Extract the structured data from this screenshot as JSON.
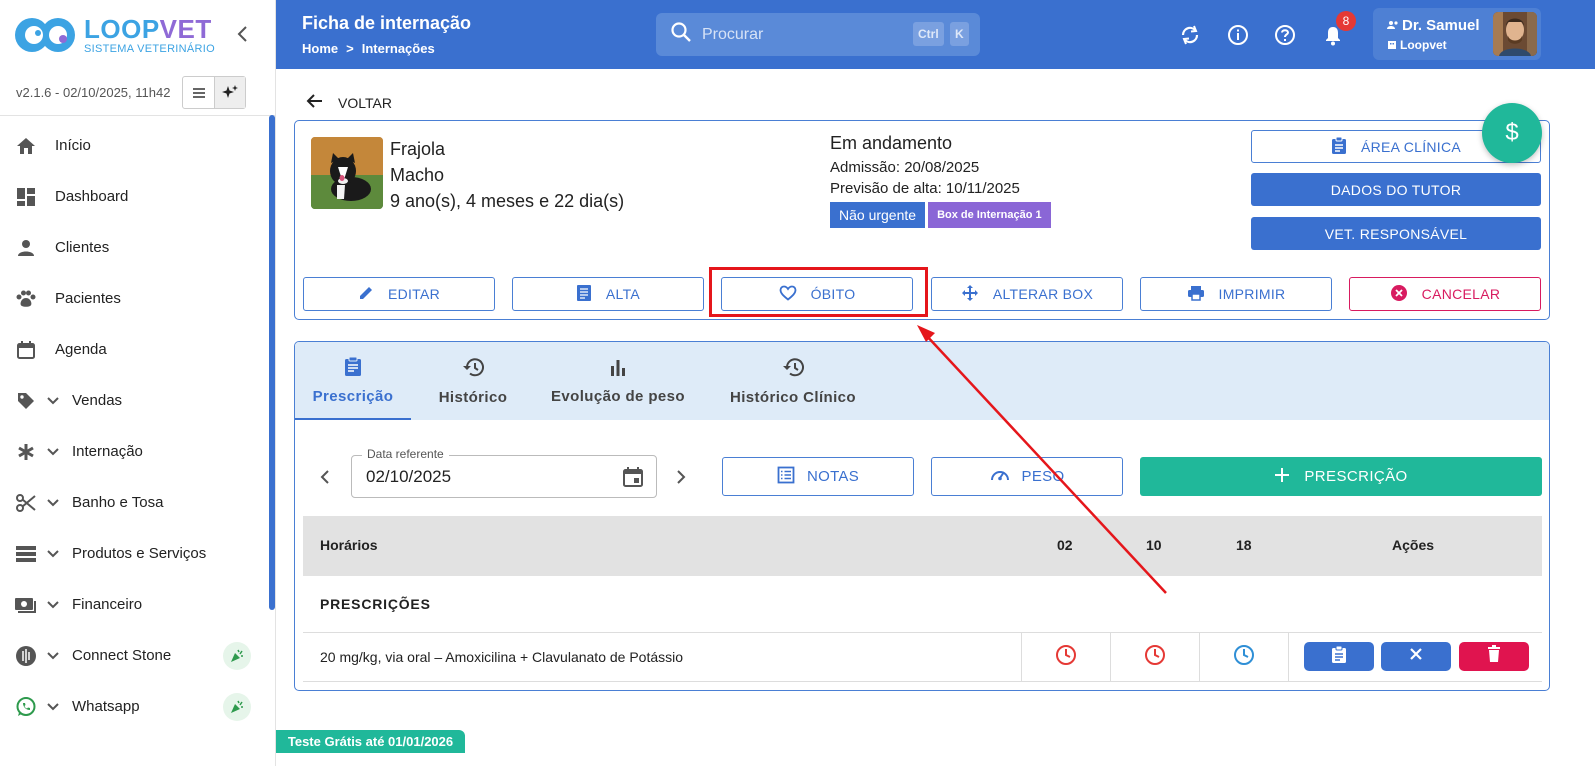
{
  "brand": {
    "name_part1": "LOOP",
    "name_part2": "VET",
    "subtitle": "SISTEMA VETERINÁRIO",
    "version": "v2.1.6 - 02/10/2025, 11h42"
  },
  "sidebar": {
    "items": [
      {
        "label": "Início",
        "icon": "home-icon"
      },
      {
        "label": "Dashboard",
        "icon": "dashboard-icon"
      },
      {
        "label": "Clientes",
        "icon": "person-icon"
      },
      {
        "label": "Pacientes",
        "icon": "paw-icon"
      },
      {
        "label": "Agenda",
        "icon": "calendar-icon"
      },
      {
        "label": "Vendas",
        "icon": "tag-icon"
      },
      {
        "label": "Internação",
        "icon": "asterisk-icon"
      },
      {
        "label": "Banho e Tosa",
        "icon": "scissors-icon"
      },
      {
        "label": "Produtos e Serviços",
        "icon": "list-icon"
      },
      {
        "label": "Financeiro",
        "icon": "cash-icon"
      },
      {
        "label": "Connect Stone",
        "icon": "stone-icon"
      },
      {
        "label": "Whatsapp",
        "icon": "whatsapp-icon"
      }
    ]
  },
  "header": {
    "title": "Ficha de internação",
    "crumbs": [
      "Home",
      ">",
      "Internações"
    ],
    "search_placeholder": "Procurar",
    "kbd1": "Ctrl",
    "kbd2": "K",
    "notif_count": "8",
    "user_name": "Dr. Samuel",
    "user_org": "Loopvet"
  },
  "back_label": "VOLTAR",
  "patient": {
    "name": "Frajola",
    "sex": "Macho",
    "age": "9 ano(s), 4 meses e 22 dia(s)"
  },
  "status": {
    "title": "Em andamento",
    "admission": "Admissão: 20/08/2025",
    "discharge_forecast": "Previsão de alta: 10/11/2025",
    "urgency_tag": "Não urgente",
    "box_tag": "Box de Internação 1"
  },
  "side_buttons": {
    "clinical": "ÁREA CLÍNICA",
    "tutor": "DADOS DO TUTOR",
    "vet": "VET. RESPONSÁVEL"
  },
  "fab_symbol": "$",
  "actions": {
    "edit": "EDITAR",
    "discharge": "ALTA",
    "death": "ÓBITO",
    "change_box": "ALTERAR BOX",
    "print": "IMPRIMIR",
    "cancel": "CANCELAR"
  },
  "tabs": [
    "Prescrição",
    "Histórico",
    "Evolução de peso",
    "Histórico Clínico"
  ],
  "date_field": {
    "label": "Data referente",
    "value": "02/10/2025"
  },
  "tools": {
    "notes": "NOTAS",
    "weight": "PESO",
    "add": "PRESCRIÇÃO"
  },
  "table": {
    "col_times": "Horários",
    "hours": [
      "02",
      "10",
      "18"
    ],
    "col_actions": "Ações",
    "section": "PRESCRIÇÕES",
    "rows": [
      {
        "text": "20 mg/kg, via oral – Amoxicilina + Clavulanato de Potássio"
      }
    ]
  },
  "trial_banner": "Teste Grátis até 01/01/2026",
  "colors": {
    "primary": "#3a70cf",
    "accent": "#20b89a",
    "danger": "#d81b60",
    "purple": "#8a66d6",
    "highlight": "#e5161b"
  }
}
